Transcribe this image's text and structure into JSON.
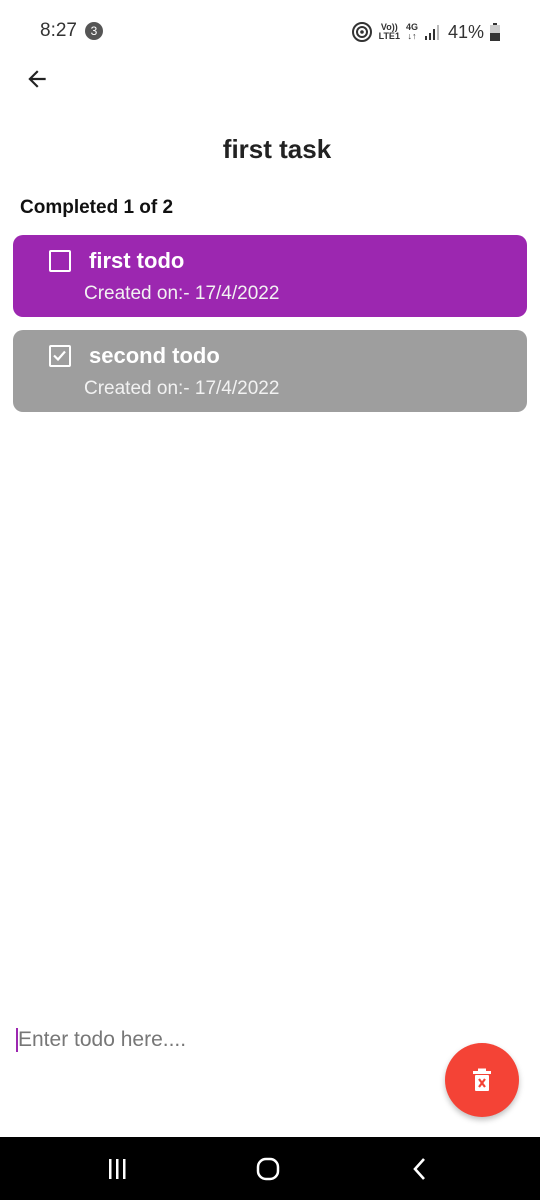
{
  "status_bar": {
    "time": "8:27",
    "notification_count": "3",
    "volte_top": "Vo))",
    "volte_bottom": "LTE1",
    "network_top": "4G",
    "network_bottom": "↓↑",
    "battery": "41%"
  },
  "header": {
    "title": "first task"
  },
  "summary": {
    "completed_text": "Completed 1 of 2"
  },
  "todos": [
    {
      "title": "first todo",
      "created": "Created on:- 17/4/2022",
      "checked": false,
      "color": "#9c27b0"
    },
    {
      "title": "second todo",
      "created": "Created on:- 17/4/2022",
      "checked": true,
      "color": "#9e9e9e"
    }
  ],
  "input": {
    "placeholder": "Enter todo here....",
    "value": ""
  },
  "fab": {
    "icon": "delete-icon",
    "color": "#f44336"
  },
  "nav": {
    "icons": [
      "recent-apps-icon",
      "home-icon",
      "back-nav-icon"
    ]
  }
}
